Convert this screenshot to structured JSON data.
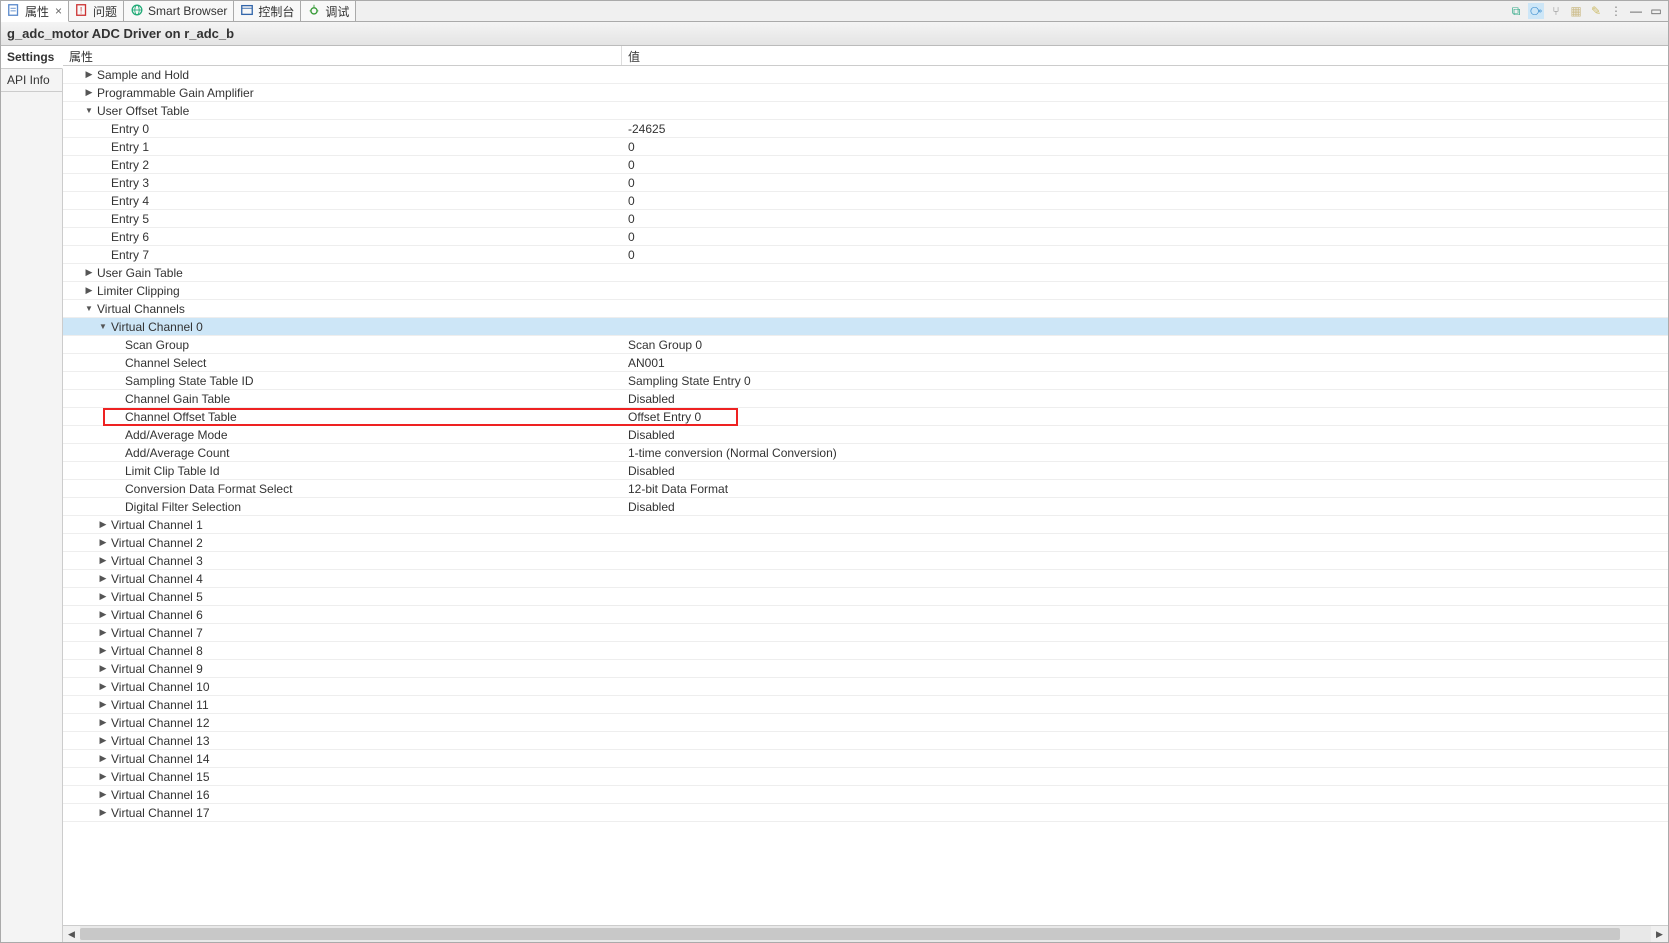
{
  "tabs": [
    {
      "id": "props",
      "label": "属性",
      "active": true,
      "closeable": true,
      "icon": "props"
    },
    {
      "id": "problems",
      "label": "问题",
      "icon": "prob"
    },
    {
      "id": "smart",
      "label": "Smart Browser",
      "icon": "globe"
    },
    {
      "id": "console",
      "label": "控制台",
      "icon": "console"
    },
    {
      "id": "debug",
      "label": "调试",
      "icon": "bug"
    }
  ],
  "title": "g_adc_motor ADC Driver on r_adc_b",
  "side_tabs": [
    {
      "id": "settings",
      "label": "Settings",
      "active": true
    },
    {
      "id": "api",
      "label": "API Info"
    }
  ],
  "columns": {
    "prop": "属性",
    "val": "值"
  },
  "tree": [
    {
      "ind": 1,
      "tw": "r",
      "label": "Sample and Hold",
      "val": ""
    },
    {
      "ind": 1,
      "tw": "r",
      "label": "Programmable Gain Amplifier",
      "val": ""
    },
    {
      "ind": 1,
      "tw": "d",
      "label": "User Offset Table",
      "val": ""
    },
    {
      "ind": 2,
      "tw": "",
      "label": "Entry 0",
      "val": "-24625"
    },
    {
      "ind": 2,
      "tw": "",
      "label": "Entry 1",
      "val": "0"
    },
    {
      "ind": 2,
      "tw": "",
      "label": "Entry 2",
      "val": "0"
    },
    {
      "ind": 2,
      "tw": "",
      "label": "Entry 3",
      "val": "0"
    },
    {
      "ind": 2,
      "tw": "",
      "label": "Entry 4",
      "val": "0"
    },
    {
      "ind": 2,
      "tw": "",
      "label": "Entry 5",
      "val": "0"
    },
    {
      "ind": 2,
      "tw": "",
      "label": "Entry 6",
      "val": "0"
    },
    {
      "ind": 2,
      "tw": "",
      "label": "Entry 7",
      "val": "0"
    },
    {
      "ind": 1,
      "tw": "r",
      "label": "User Gain Table",
      "val": ""
    },
    {
      "ind": 1,
      "tw": "r",
      "label": "Limiter Clipping",
      "val": ""
    },
    {
      "ind": 1,
      "tw": "d",
      "label": "Virtual Channels",
      "val": ""
    },
    {
      "ind": 2,
      "tw": "d",
      "label": "Virtual Channel 0",
      "val": "",
      "sel": true
    },
    {
      "ind": 3,
      "tw": "",
      "label": "Scan Group",
      "val": "Scan Group 0"
    },
    {
      "ind": 3,
      "tw": "",
      "label": "Channel Select",
      "val": "AN001"
    },
    {
      "ind": 3,
      "tw": "",
      "label": "Sampling State Table ID",
      "val": "Sampling State Entry 0"
    },
    {
      "ind": 3,
      "tw": "",
      "label": "Channel Gain Table",
      "val": "Disabled"
    },
    {
      "ind": 3,
      "tw": "",
      "label": "Channel Offset Table",
      "val": "Offset Entry 0",
      "hl": true
    },
    {
      "ind": 3,
      "tw": "",
      "label": "Add/Average Mode",
      "val": "Disabled"
    },
    {
      "ind": 3,
      "tw": "",
      "label": "Add/Average Count",
      "val": "1-time conversion (Normal Conversion)"
    },
    {
      "ind": 3,
      "tw": "",
      "label": "Limit Clip Table Id",
      "val": "Disabled"
    },
    {
      "ind": 3,
      "tw": "",
      "label": "Conversion Data Format Select",
      "val": "12-bit Data Format"
    },
    {
      "ind": 3,
      "tw": "",
      "label": "Digital Filter Selection",
      "val": "Disabled"
    },
    {
      "ind": 2,
      "tw": "r",
      "label": "Virtual Channel 1",
      "val": ""
    },
    {
      "ind": 2,
      "tw": "r",
      "label": "Virtual Channel 2",
      "val": ""
    },
    {
      "ind": 2,
      "tw": "r",
      "label": "Virtual Channel 3",
      "val": ""
    },
    {
      "ind": 2,
      "tw": "r",
      "label": "Virtual Channel 4",
      "val": ""
    },
    {
      "ind": 2,
      "tw": "r",
      "label": "Virtual Channel 5",
      "val": ""
    },
    {
      "ind": 2,
      "tw": "r",
      "label": "Virtual Channel 6",
      "val": ""
    },
    {
      "ind": 2,
      "tw": "r",
      "label": "Virtual Channel 7",
      "val": ""
    },
    {
      "ind": 2,
      "tw": "r",
      "label": "Virtual Channel 8",
      "val": ""
    },
    {
      "ind": 2,
      "tw": "r",
      "label": "Virtual Channel 9",
      "val": ""
    },
    {
      "ind": 2,
      "tw": "r",
      "label": "Virtual Channel 10",
      "val": ""
    },
    {
      "ind": 2,
      "tw": "r",
      "label": "Virtual Channel 11",
      "val": ""
    },
    {
      "ind": 2,
      "tw": "r",
      "label": "Virtual Channel 12",
      "val": ""
    },
    {
      "ind": 2,
      "tw": "r",
      "label": "Virtual Channel 13",
      "val": ""
    },
    {
      "ind": 2,
      "tw": "r",
      "label": "Virtual Channel 14",
      "val": ""
    },
    {
      "ind": 2,
      "tw": "r",
      "label": "Virtual Channel 15",
      "val": ""
    },
    {
      "ind": 2,
      "tw": "r",
      "label": "Virtual Channel 16",
      "val": ""
    },
    {
      "ind": 2,
      "tw": "r",
      "label": "Virtual Channel 17",
      "val": ""
    }
  ],
  "toolbar_icons": [
    {
      "name": "new-view-icon",
      "glyph": "⧉",
      "color": "#3a8"
    },
    {
      "name": "tree-icon",
      "glyph": "⧂",
      "color": "#38c",
      "active": true
    },
    {
      "name": "filter-icon",
      "glyph": "⑂",
      "color": "#888"
    },
    {
      "name": "categories-icon",
      "glyph": "▦",
      "color": "#cb8"
    },
    {
      "name": "pin-icon",
      "glyph": "✎",
      "color": "#cb6"
    },
    {
      "name": "menu-icon",
      "glyph": "⋮",
      "color": "#888"
    },
    {
      "name": "minimize-icon",
      "glyph": "—",
      "color": "#555"
    },
    {
      "name": "maximize-icon",
      "glyph": "▭",
      "color": "#555"
    }
  ]
}
